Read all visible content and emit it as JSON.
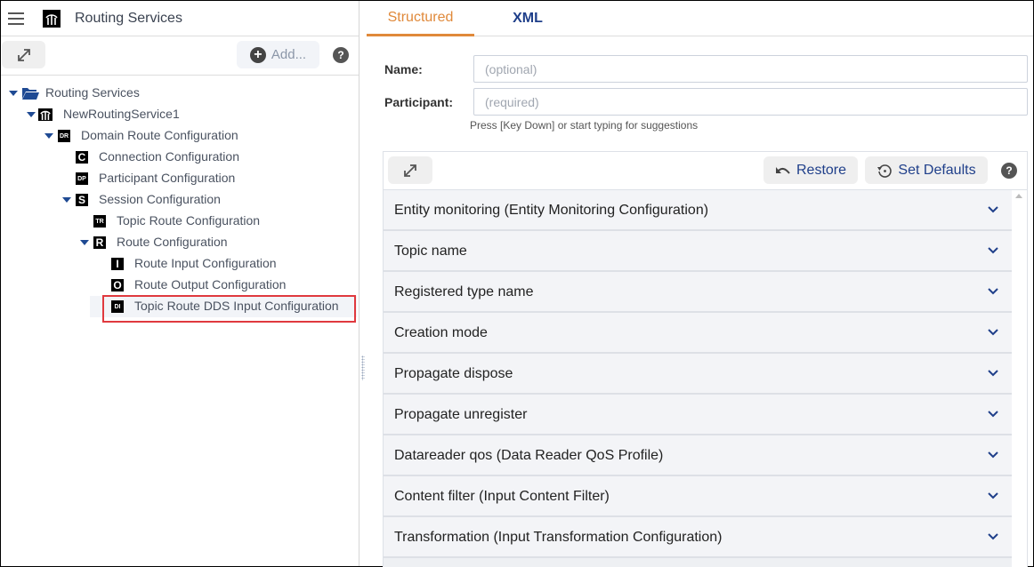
{
  "app": {
    "title": "Routing Services",
    "add_label": "Add...",
    "help_glyph": "?"
  },
  "tree": [
    {
      "label": "Routing Services",
      "icon": "folder-icon",
      "tag": "",
      "depth": 0,
      "expanded": true
    },
    {
      "label": "NewRoutingService1",
      "icon": "routing-service-icon",
      "tag": "",
      "depth": 1,
      "expanded": true
    },
    {
      "label": "Domain Route Configuration",
      "icon": "tag-icon",
      "tag": "DR",
      "depth": 2,
      "expanded": true
    },
    {
      "label": "Connection Configuration",
      "icon": "tag-icon",
      "tag": "C",
      "depth": 3,
      "expanded": null
    },
    {
      "label": "Participant Configuration",
      "icon": "tag-icon",
      "tag": "DP",
      "depth": 3,
      "expanded": null
    },
    {
      "label": "Session Configuration",
      "icon": "tag-icon",
      "tag": "S",
      "depth": 3,
      "expanded": true
    },
    {
      "label": "Topic Route Configuration",
      "icon": "tag-icon",
      "tag": "TR",
      "depth": 4,
      "expanded": null
    },
    {
      "label": "Route Configuration",
      "icon": "tag-icon",
      "tag": "R",
      "depth": 4,
      "expanded": true
    },
    {
      "label": "Route Input Configuration",
      "icon": "tag-icon",
      "tag": "I",
      "depth": 5,
      "expanded": null
    },
    {
      "label": "Route Output Configuration",
      "icon": "tag-icon",
      "tag": "O",
      "depth": 5,
      "expanded": null
    },
    {
      "label": "Topic Route DDS Input Configuration",
      "icon": "tag-icon",
      "tag": "DI",
      "depth": 5,
      "expanded": null,
      "selected": true
    }
  ],
  "tabs": [
    {
      "label": "Structured",
      "active": true
    },
    {
      "label": "XML",
      "active": false
    }
  ],
  "form": {
    "name_label": "Name:",
    "name_value": "",
    "name_placeholder": "(optional)",
    "participant_label": "Participant:",
    "participant_value": "",
    "participant_placeholder": "(required)",
    "participant_hint": "Press [Key Down] or start typing for suggestions"
  },
  "panel": {
    "restore_label": "Restore",
    "set_defaults_label": "Set Defaults",
    "help_glyph": "?",
    "sections": [
      "Entity monitoring (Entity Monitoring Configuration)",
      "Topic name",
      "Registered type name",
      "Creation mode",
      "Propagate dispose",
      "Propagate unregister",
      "Datareader qos (Data Reader QoS Profile)",
      "Content filter (Input Content Filter)",
      "Transformation (Input Transformation Configuration)"
    ]
  },
  "colors": {
    "accent_orange": "#e0893a",
    "accent_blue": "#1f3f8a",
    "selection_outline": "#e0393e"
  }
}
